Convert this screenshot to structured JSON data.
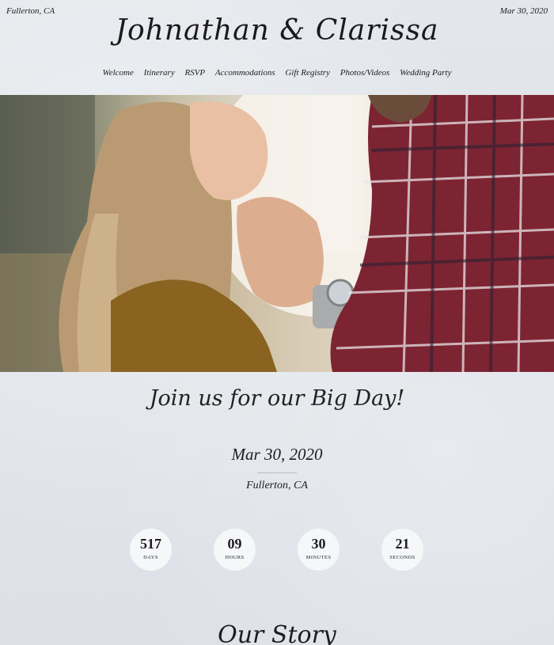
{
  "header": {
    "location": "Fullerton, CA",
    "date": "Mar 30, 2020",
    "couple_names": "Johnathan & Clarissa"
  },
  "nav": {
    "items": [
      "Welcome",
      "Itinerary",
      "RSVP",
      "Accommodations",
      "Gift Registry",
      "Photos/Videos",
      "Wedding Party"
    ]
  },
  "hero": {
    "alt": "couple-holding-hands-photo"
  },
  "main": {
    "tagline": "Join us for our Big Day!",
    "event_date": "Mar 30, 2020",
    "event_location": "Fullerton, CA"
  },
  "countdown": [
    {
      "value": "517",
      "label": "DAYS"
    },
    {
      "value": "09",
      "label": "HOURS"
    },
    {
      "value": "30",
      "label": "MINUTES"
    },
    {
      "value": "21",
      "label": "SECONDS"
    }
  ],
  "story": {
    "heading": "Our Story"
  },
  "colors": {
    "background": "#dfe3e9",
    "text": "#1d1d1f",
    "circle": "#f6f7f9"
  }
}
